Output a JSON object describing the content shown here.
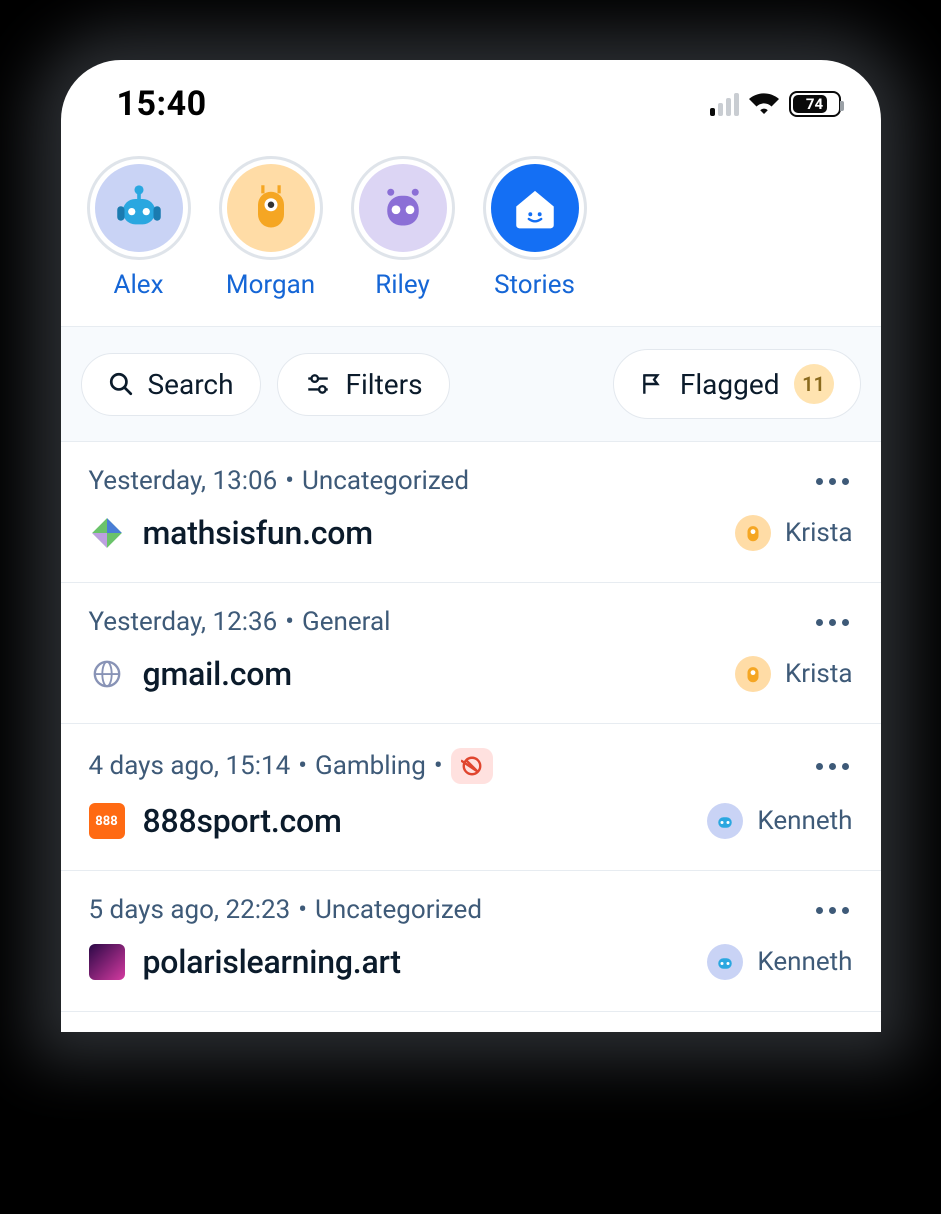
{
  "status": {
    "time": "15:40",
    "battery": "74"
  },
  "profiles": [
    {
      "label": "Alex",
      "variant": "av-blue"
    },
    {
      "label": "Morgan",
      "variant": "av-orange"
    },
    {
      "label": "Riley",
      "variant": "av-purple"
    },
    {
      "label": "Stories",
      "variant": "av-solid-blue"
    }
  ],
  "controls": {
    "search_label": "Search",
    "filters_label": "Filters",
    "flagged_label": "Flagged",
    "flagged_count": "11"
  },
  "items": [
    {
      "time": "Yesterday, 13:06",
      "category": "Uncategorized",
      "blocked": false,
      "site": "mathsisfun.com",
      "child": "Krista",
      "child_variant": "av-orange",
      "fav": "gem"
    },
    {
      "time": "Yesterday, 12:36",
      "category": "General",
      "blocked": false,
      "site": "gmail.com",
      "child": "Krista",
      "child_variant": "av-orange",
      "fav": "globe"
    },
    {
      "time": "4 days ago, 15:14",
      "category": "Gambling",
      "blocked": true,
      "site": "888sport.com",
      "child": "Kenneth",
      "child_variant": "av-blue",
      "fav": "888"
    },
    {
      "time": "5 days ago, 22:23",
      "category": "Uncategorized",
      "blocked": false,
      "site": "polarislearning.art",
      "child": "Kenneth",
      "child_variant": "av-blue",
      "fav": "purple"
    }
  ]
}
